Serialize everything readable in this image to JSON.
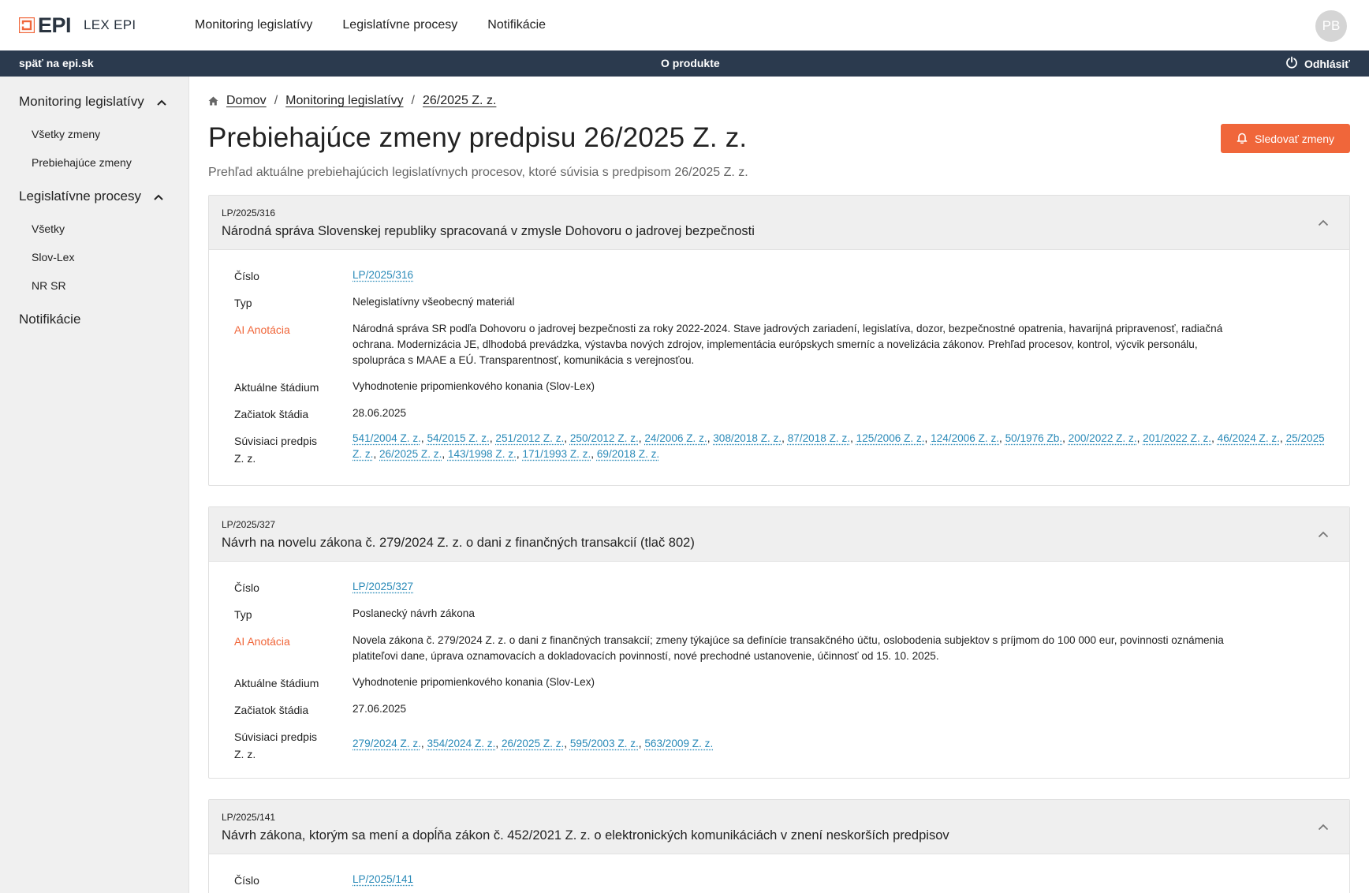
{
  "header": {
    "logo_text": "EPI",
    "product_name": "LEX EPI",
    "nav": [
      "Monitoring legislatívy",
      "Legislatívne procesy",
      "Notifikácie"
    ],
    "avatar_initials": "PB"
  },
  "subbar": {
    "back_label": "späť na epi.sk",
    "about_label": "O produkte",
    "logout_label": "Odhlásiť"
  },
  "sidebar": {
    "sections": [
      {
        "label": "Monitoring legislatívy",
        "expanded": true,
        "items": [
          "Všetky zmeny",
          "Prebiehajúce zmeny"
        ]
      },
      {
        "label": "Legislatívne procesy",
        "expanded": true,
        "items": [
          "Všetky",
          "Slov-Lex",
          "NR SR"
        ]
      },
      {
        "label": "Notifikácie",
        "expanded": false,
        "items": []
      }
    ]
  },
  "breadcrumb": [
    "Domov",
    "Monitoring legislatívy",
    "26/2025 Z. z."
  ],
  "page": {
    "title": "Prebiehajúce zmeny predpisu 26/2025 Z. z.",
    "subtitle": "Prehľad aktuálne prebiehajúcich legislatívnych procesov, ktoré súvisia s predpisom 26/2025 Z. z.",
    "follow_button": "Sledovať zmeny"
  },
  "labels": {
    "number": "Číslo",
    "type": "Typ",
    "ai_annotation": "AI Anotácia",
    "current_stage": "Aktuálne štádium",
    "stage_start": "Začiatok štádia",
    "related_line1": "Súvisiaci predpis",
    "related_line2": "Z. z."
  },
  "cards": [
    {
      "code": "LP/2025/316",
      "title": "Národná správa Slovenskej republiky spracovaná v zmysle Dohovoru o jadrovej bezpečnosti",
      "number": "LP/2025/316",
      "type": "Nelegislatívny všeobecný materiál",
      "annotation_lines": [
        "Národná správa SR podľa Dohovoru o jadrovej bezpečnosti za roky 2022-2024. Stave jadrových zariadení, legislatíva, dozor, bezpečnostné opatrenia, havarijná pripravenosť, radiačná",
        "ochrana. Modernizácia JE, dlhodobá prevádzka, výstavba nových zdrojov, implementácia európskych smerníc a novelizácia zákonov. Prehľad procesov, kontrol, výcvik personálu,",
        "spolupráca s MAAE a EÚ. Transparentnosť, komunikácia s verejnosťou."
      ],
      "stage": "Vyhodnotenie pripomienkového konania (Slov-Lex)",
      "stage_start": "28.06.2025",
      "related": [
        "541/2004 Z. z.",
        "54/2015 Z. z.",
        "251/2012 Z. z.",
        "250/2012 Z. z.",
        "24/2006 Z. z.",
        "308/2018 Z. z.",
        "87/2018 Z. z.",
        "125/2006 Z. z.",
        "124/2006 Z. z.",
        "50/1976 Zb.",
        "200/2022 Z. z.",
        "201/2022 Z. z.",
        "46/2024 Z. z.",
        "25/2025 Z. z.",
        "26/2025 Z. z.",
        "143/1998 Z. z.",
        "171/1993 Z. z.",
        "69/2018 Z. z."
      ]
    },
    {
      "code": "LP/2025/327",
      "title": "Návrh na novelu zákona č. 279/2024 Z. z. o dani z finančných transakcií (tlač 802)",
      "number": "LP/2025/327",
      "type": "Poslanecký návrh zákona",
      "annotation_lines": [
        "Novela zákona č. 279/2024 Z. z. o dani z finančných transakcií; zmeny týkajúce sa definície transakčného účtu, oslobodenia subjektov s príjmom do 100 000 eur, povinnosti oznámenia",
        "platiteľovi dane, úprava oznamovacích a dokladovacích povinností, nové prechodné ustanovenie, účinnosť od 15. 10. 2025."
      ],
      "stage": "Vyhodnotenie pripomienkového konania (Slov-Lex)",
      "stage_start": "27.06.2025",
      "related": [
        "279/2024 Z. z.",
        "354/2024 Z. z.",
        "26/2025 Z. z.",
        "595/2003 Z. z.",
        "563/2009 Z. z."
      ]
    },
    {
      "code": "LP/2025/141",
      "title": "Návrh zákona, ktorým sa mení a dopĺňa zákon č. 452/2021 Z. z. o elektronických komunikáciách v znení neskorších predpisov",
      "number": "LP/2025/141"
    }
  ],
  "colors": {
    "accent": "#f0663a",
    "darkbar": "#2b3a4e",
    "link": "#2a8ab8"
  }
}
